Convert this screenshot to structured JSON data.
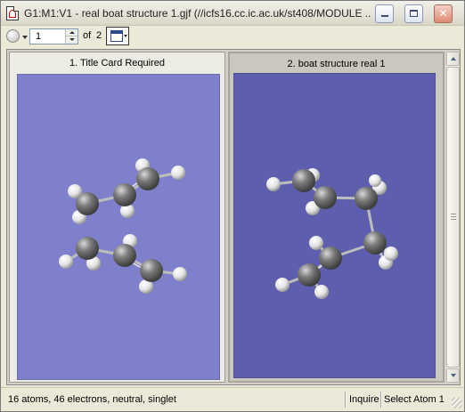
{
  "window": {
    "title": "G1:M1:V1 - real boat structure 1.gjf (//icfs16.cc.ic.ac.uk/st408/MODULE ..."
  },
  "toolbar": {
    "molecule_index": "1",
    "of_label": "of",
    "molecule_count": "2"
  },
  "panels": [
    {
      "label": "1.  Title Card Required"
    },
    {
      "label": "2.  boat structure real 1"
    }
  ],
  "status": {
    "text": "16 atoms, 46 electrons, neutral, singlet",
    "mode": "Inquire",
    "action": "Select Atom 1"
  },
  "colors": {
    "viewport_left_bg": "#7e80cc",
    "viewport_right_bg": "#5d5fae",
    "carbon": "#6b6b6b",
    "hydrogen": "#e6e6e6"
  }
}
